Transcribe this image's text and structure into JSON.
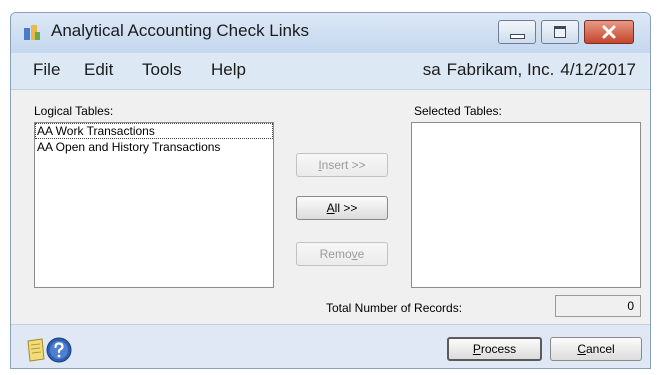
{
  "window": {
    "title": "Analytical Accounting Check Links",
    "controls": [
      "minimize",
      "maximize",
      "close"
    ]
  },
  "menu": {
    "items": [
      "File",
      "Edit",
      "Tools",
      "Help"
    ],
    "user": "sa",
    "company": "Fabrikam, Inc.",
    "date": "4/12/2017"
  },
  "logical_tables": {
    "label": "Logical Tables:",
    "items": [
      "AA Work Transactions",
      "AA Open and History Transactions"
    ]
  },
  "selected_tables": {
    "label": "Selected Tables:",
    "items": []
  },
  "buttons": {
    "insert": {
      "pre": "",
      "key": "I",
      "post": "nsert >>",
      "enabled": false
    },
    "all": {
      "pre": "",
      "key": "A",
      "post": "ll >>",
      "enabled": true
    },
    "remove": {
      "pre": "Remo",
      "key": "v",
      "post": "e",
      "enabled": false
    },
    "process": {
      "pre": "",
      "key": "P",
      "post": "rocess"
    },
    "cancel": {
      "pre": "",
      "key": "C",
      "post": "ancel"
    }
  },
  "records": {
    "label": "Total Number of Records:",
    "value": "0"
  },
  "icons": [
    "app-icon",
    "minimize-icon",
    "maximize-icon",
    "close-icon",
    "note-icon",
    "help-icon"
  ]
}
